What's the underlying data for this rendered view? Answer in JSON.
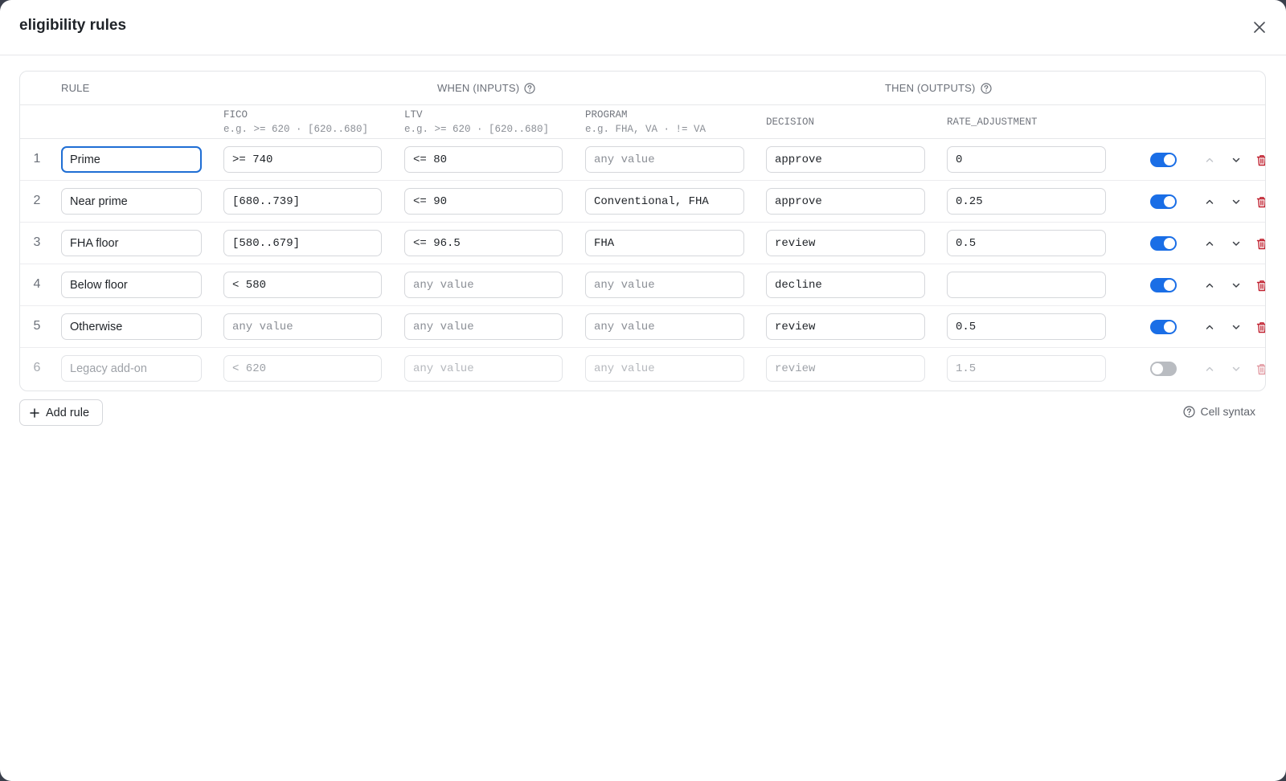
{
  "modal": {
    "title": "eligibility rules"
  },
  "table": {
    "group_headers": {
      "rule": "RULE",
      "when": "WHEN (INPUTS)",
      "then": "THEN (OUTPUTS)"
    },
    "columns": [
      {
        "name": "FICO",
        "hint": "e.g. >= 620 · [620..680]"
      },
      {
        "name": "LTV",
        "hint": "e.g. >= 620 · [620..680]"
      },
      {
        "name": "PROGRAM",
        "hint": "e.g. FHA, VA · != VA"
      },
      {
        "name": "DECISION",
        "hint": ""
      },
      {
        "name": "RATE_ADJUSTMENT",
        "hint": ""
      }
    ],
    "placeholder": "any value",
    "rows": [
      {
        "num": "1",
        "rule": "Prime",
        "fico": ">= 740",
        "ltv": "<= 80",
        "program": "",
        "decision": "approve",
        "rate": "0",
        "enabled": true
      },
      {
        "num": "2",
        "rule": "Near prime",
        "fico": "[680..739]",
        "ltv": "<= 90",
        "program": "Conventional, FHA",
        "decision": "approve",
        "rate": "0.25",
        "enabled": true
      },
      {
        "num": "3",
        "rule": "FHA floor",
        "fico": "[580..679]",
        "ltv": "<= 96.5",
        "program": "FHA",
        "decision": "review",
        "rate": "0.5",
        "enabled": true
      },
      {
        "num": "4",
        "rule": "Below floor",
        "fico": "< 580",
        "ltv": "",
        "program": "",
        "decision": "decline",
        "rate": "",
        "enabled": true
      },
      {
        "num": "5",
        "rule": "Otherwise",
        "fico": "",
        "ltv": "",
        "program": "",
        "decision": "review",
        "rate": "0.5",
        "enabled": true
      },
      {
        "num": "6",
        "rule": "Legacy add-on",
        "fico": "< 620",
        "ltv": "",
        "program": "",
        "decision": "review",
        "rate": "1.5",
        "enabled": false
      }
    ]
  },
  "footer": {
    "add_rule_label": "Add rule",
    "cell_syntax_label": "Cell syntax"
  },
  "colors": {
    "accent": "#1a6ee6",
    "focus": "#1f6ed4",
    "delete": "#c0202f"
  }
}
